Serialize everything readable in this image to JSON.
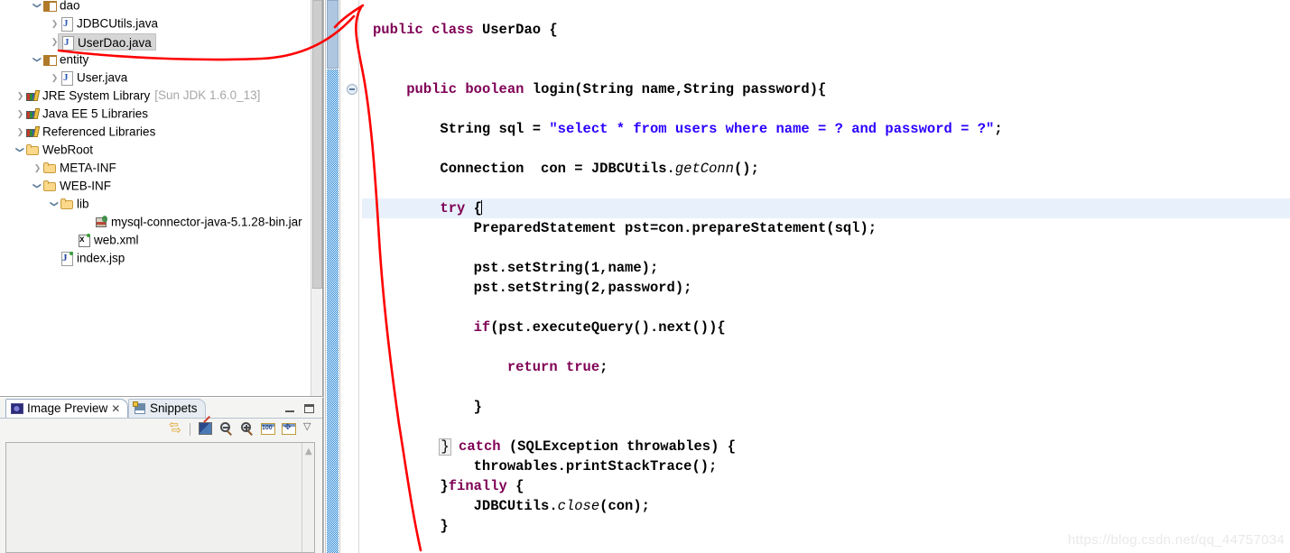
{
  "explorer": {
    "name": "package-explorer",
    "scrollbar": {
      "present": true
    },
    "tree": [
      {
        "label": "dao",
        "icon": "package-icon",
        "arrow": "open",
        "indent": 1,
        "partial": true,
        "selected": false,
        "suffix": ""
      },
      {
        "label": "JDBCUtils.java",
        "icon": "java-file-icon",
        "arrow": "closed",
        "indent": 2,
        "selected": false,
        "suffix": ""
      },
      {
        "label": "UserDao.java",
        "icon": "java-file-icon",
        "arrow": "closed",
        "indent": 2,
        "selected": true,
        "suffix": ""
      },
      {
        "label": "entity",
        "icon": "package-icon",
        "arrow": "open",
        "indent": 1,
        "selected": false,
        "suffix": ""
      },
      {
        "label": "User.java",
        "icon": "java-file-icon",
        "arrow": "closed",
        "indent": 2,
        "selected": false,
        "suffix": ""
      },
      {
        "label": "JRE System Library",
        "icon": "library-icon",
        "arrow": "closed",
        "indent": 0,
        "selected": false,
        "suffix": "[Sun JDK 1.6.0_13]"
      },
      {
        "label": "Java EE 5 Libraries",
        "icon": "library-icon",
        "arrow": "closed",
        "indent": 0,
        "selected": false,
        "suffix": ""
      },
      {
        "label": "Referenced Libraries",
        "icon": "library-icon",
        "arrow": "closed",
        "indent": 0,
        "selected": false,
        "suffix": ""
      },
      {
        "label": "WebRoot",
        "icon": "folder-icon",
        "arrow": "open",
        "indent": 0,
        "selected": false,
        "suffix": ""
      },
      {
        "label": "META-INF",
        "icon": "folder-icon",
        "arrow": "closed",
        "indent": 1,
        "selected": false,
        "suffix": ""
      },
      {
        "label": "WEB-INF",
        "icon": "folder-icon",
        "arrow": "open",
        "indent": 1,
        "selected": false,
        "suffix": ""
      },
      {
        "label": "lib",
        "icon": "folder-icon",
        "arrow": "open",
        "indent": 2,
        "selected": false,
        "suffix": ""
      },
      {
        "label": "mysql-connector-java-5.1.28-bin.jar",
        "icon": "jar-icon",
        "arrow": "none",
        "indent": 4,
        "selected": false,
        "suffix": ""
      },
      {
        "label": "web.xml",
        "icon": "xml-file-icon",
        "arrow": "none",
        "indent": 3,
        "selected": false,
        "suffix": ""
      },
      {
        "label": "index.jsp",
        "icon": "jsp-file-icon",
        "arrow": "none",
        "indent": 2,
        "selected": false,
        "suffix": ""
      }
    ]
  },
  "bottom_view": {
    "tabs": [
      {
        "label": "Image Preview",
        "icon": "image-preview-icon",
        "active": true,
        "close": "✕"
      },
      {
        "label": "Snippets",
        "icon": "snippets-icon",
        "active": false,
        "close": ""
      }
    ],
    "view_buttons": [
      {
        "name": "minimize-button",
        "tooltip": "Minimize"
      },
      {
        "name": "maximize-button",
        "tooltip": "Maximize"
      }
    ],
    "toolbar": [
      {
        "name": "sync-icon",
        "label": ""
      },
      {
        "name": "separator",
        "label": ""
      },
      {
        "name": "image-edit-icon",
        "label": ""
      },
      {
        "name": "zoom-out-icon",
        "label": ""
      },
      {
        "name": "zoom-in-icon",
        "label": ""
      },
      {
        "name": "actual-size-icon",
        "label": "100"
      },
      {
        "name": "fit-to-window-icon",
        "label": ""
      },
      {
        "name": "view-menu-chevron-icon",
        "label": ""
      }
    ]
  },
  "editor": {
    "fold_markers": [
      {
        "line": 4
      }
    ],
    "current_line": 10,
    "lines": [
      {
        "n": 1,
        "segments": []
      },
      {
        "n": 2,
        "segments": [
          {
            "t": "public ",
            "c": "kw"
          },
          {
            "t": "class ",
            "c": "kw"
          },
          {
            "t": "UserDao {",
            "c": "pl"
          }
        ]
      },
      {
        "n": 3,
        "segments": []
      },
      {
        "n": 4,
        "segments": []
      },
      {
        "n": 5,
        "segments": [
          {
            "t": "    ",
            "c": "pl"
          },
          {
            "t": "public ",
            "c": "kw"
          },
          {
            "t": "boolean ",
            "c": "kw"
          },
          {
            "t": "login(String name,String password){",
            "c": "pl"
          }
        ]
      },
      {
        "n": 6,
        "segments": []
      },
      {
        "n": 7,
        "segments": [
          {
            "t": "        String sql = ",
            "c": "pl"
          },
          {
            "t": "\"select * from users where name = ? and password = ?\"",
            "c": "st"
          },
          {
            "t": ";",
            "c": "pl"
          }
        ]
      },
      {
        "n": 8,
        "segments": []
      },
      {
        "n": 9,
        "segments": [
          {
            "t": "        Connection  con = JDBCUtils.",
            "c": "pl"
          },
          {
            "t": "getConn",
            "c": "it"
          },
          {
            "t": "();",
            "c": "pl"
          }
        ]
      },
      {
        "n": 10,
        "segments": []
      },
      {
        "n": 11,
        "segments": [
          {
            "t": "        ",
            "c": "pl"
          },
          {
            "t": "try ",
            "c": "kw"
          },
          {
            "t": "{",
            "c": "pl"
          },
          {
            "t": "",
            "c": "cursor"
          }
        ],
        "highlight": true
      },
      {
        "n": 12,
        "segments": [
          {
            "t": "            PreparedStatement pst=con.prepareStatement(sql);",
            "c": "pl"
          }
        ]
      },
      {
        "n": 13,
        "segments": []
      },
      {
        "n": 14,
        "segments": [
          {
            "t": "            pst.setString(1,name);",
            "c": "pl"
          }
        ]
      },
      {
        "n": 15,
        "segments": [
          {
            "t": "            pst.setString(2,password);",
            "c": "pl"
          }
        ]
      },
      {
        "n": 16,
        "segments": []
      },
      {
        "n": 17,
        "segments": [
          {
            "t": "            ",
            "c": "pl"
          },
          {
            "t": "if",
            "c": "kw"
          },
          {
            "t": "(pst.executeQuery().next()){",
            "c": "pl"
          }
        ]
      },
      {
        "n": 18,
        "segments": []
      },
      {
        "n": 19,
        "segments": [
          {
            "t": "                ",
            "c": "pl"
          },
          {
            "t": "return ",
            "c": "kw"
          },
          {
            "t": "true",
            "c": "kw"
          },
          {
            "t": ";",
            "c": "pl"
          }
        ]
      },
      {
        "n": 20,
        "segments": []
      },
      {
        "n": 21,
        "segments": [
          {
            "t": "            }",
            "c": "pl"
          }
        ]
      },
      {
        "n": 22,
        "segments": []
      },
      {
        "n": 23,
        "segments": [
          {
            "t": "        ",
            "c": "pl"
          },
          {
            "t": "}",
            "c": "brk"
          },
          {
            "t": " ",
            "c": "pl"
          },
          {
            "t": "catch ",
            "c": "kw"
          },
          {
            "t": "(SQLException throwables) {",
            "c": "pl"
          }
        ]
      },
      {
        "n": 24,
        "segments": [
          {
            "t": "            throwables.printStackTrace();",
            "c": "pl"
          }
        ]
      },
      {
        "n": 25,
        "segments": [
          {
            "t": "        }",
            "c": "pl"
          },
          {
            "t": "finally ",
            "c": "kw"
          },
          {
            "t": "{",
            "c": "pl"
          }
        ]
      },
      {
        "n": 26,
        "segments": [
          {
            "t": "            JDBCUtils.",
            "c": "pl"
          },
          {
            "t": "close",
            "c": "it"
          },
          {
            "t": "(con);",
            "c": "pl"
          }
        ]
      },
      {
        "n": 27,
        "segments": [
          {
            "t": "        }",
            "c": "pl"
          }
        ]
      }
    ]
  },
  "annotation": {
    "color": "#ff0000",
    "shapes": [
      "arrow-curve-from-bottom-to-top",
      "underline-curve-under-userdao"
    ]
  },
  "watermark": {
    "text": "https://blog.csdn.net/qq_44757034",
    "color": "#e9e9e9"
  }
}
